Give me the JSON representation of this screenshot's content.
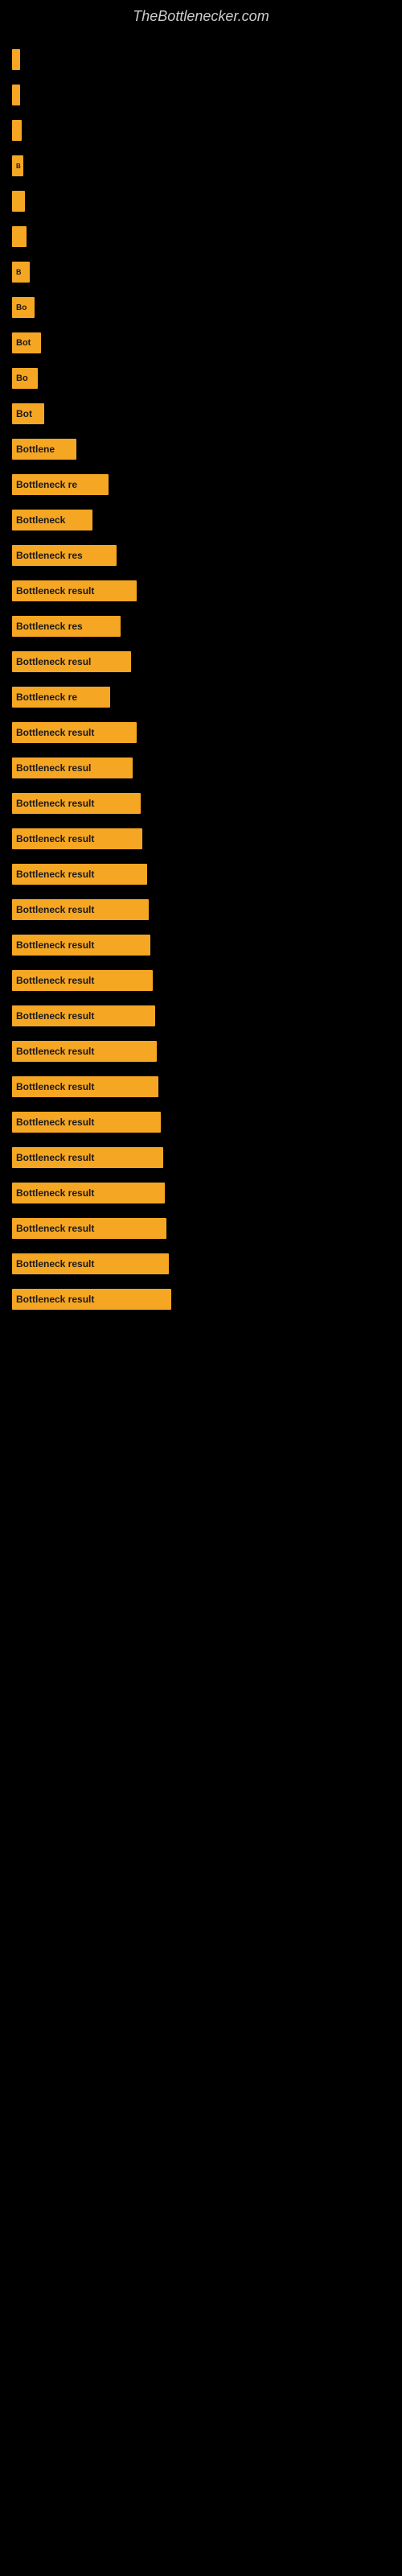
{
  "site": {
    "title": "TheBottlenecker.com"
  },
  "chart": {
    "rows": [
      {
        "id": 1,
        "label": "",
        "width": 8,
        "fontSize": 0
      },
      {
        "id": 2,
        "label": "",
        "width": 10,
        "fontSize": 0
      },
      {
        "id": 3,
        "label": "",
        "width": 12,
        "fontSize": 0
      },
      {
        "id": 4,
        "label": "B",
        "width": 14,
        "fontSize": 8
      },
      {
        "id": 5,
        "label": "",
        "width": 16,
        "fontSize": 0
      },
      {
        "id": 6,
        "label": "",
        "width": 18,
        "fontSize": 0
      },
      {
        "id": 7,
        "label": "B",
        "width": 22,
        "fontSize": 9
      },
      {
        "id": 8,
        "label": "Bo",
        "width": 28,
        "fontSize": 10
      },
      {
        "id": 9,
        "label": "Bot",
        "width": 36,
        "fontSize": 11
      },
      {
        "id": 10,
        "label": "Bo",
        "width": 32,
        "fontSize": 11
      },
      {
        "id": 11,
        "label": "Bot",
        "width": 40,
        "fontSize": 12
      },
      {
        "id": 12,
        "label": "Bottlene",
        "width": 80,
        "fontSize": 12
      },
      {
        "id": 13,
        "label": "Bottleneck re",
        "width": 120,
        "fontSize": 12
      },
      {
        "id": 14,
        "label": "Bottleneck",
        "width": 100,
        "fontSize": 12
      },
      {
        "id": 15,
        "label": "Bottleneck res",
        "width": 130,
        "fontSize": 12
      },
      {
        "id": 16,
        "label": "Bottleneck result",
        "width": 155,
        "fontSize": 12
      },
      {
        "id": 17,
        "label": "Bottleneck res",
        "width": 135,
        "fontSize": 12
      },
      {
        "id": 18,
        "label": "Bottleneck resul",
        "width": 148,
        "fontSize": 12
      },
      {
        "id": 19,
        "label": "Bottleneck re",
        "width": 122,
        "fontSize": 12
      },
      {
        "id": 20,
        "label": "Bottleneck result",
        "width": 155,
        "fontSize": 12
      },
      {
        "id": 21,
        "label": "Bottleneck resul",
        "width": 150,
        "fontSize": 12
      },
      {
        "id": 22,
        "label": "Bottleneck result",
        "width": 160,
        "fontSize": 12
      },
      {
        "id": 23,
        "label": "Bottleneck result",
        "width": 162,
        "fontSize": 12
      },
      {
        "id": 24,
        "label": "Bottleneck result",
        "width": 168,
        "fontSize": 12
      },
      {
        "id": 25,
        "label": "Bottleneck result",
        "width": 170,
        "fontSize": 12
      },
      {
        "id": 26,
        "label": "Bottleneck result",
        "width": 172,
        "fontSize": 12
      },
      {
        "id": 27,
        "label": "Bottleneck result",
        "width": 175,
        "fontSize": 12
      },
      {
        "id": 28,
        "label": "Bottleneck result",
        "width": 178,
        "fontSize": 12
      },
      {
        "id": 29,
        "label": "Bottleneck result",
        "width": 180,
        "fontSize": 12
      },
      {
        "id": 30,
        "label": "Bottleneck result",
        "width": 182,
        "fontSize": 12
      },
      {
        "id": 31,
        "label": "Bottleneck result",
        "width": 185,
        "fontSize": 12
      },
      {
        "id": 32,
        "label": "Bottleneck result",
        "width": 188,
        "fontSize": 12
      },
      {
        "id": 33,
        "label": "Bottleneck result",
        "width": 190,
        "fontSize": 12
      },
      {
        "id": 34,
        "label": "Bottleneck result",
        "width": 192,
        "fontSize": 12
      },
      {
        "id": 35,
        "label": "Bottleneck result",
        "width": 195,
        "fontSize": 12
      },
      {
        "id": 36,
        "label": "Bottleneck result",
        "width": 198,
        "fontSize": 12
      }
    ]
  }
}
